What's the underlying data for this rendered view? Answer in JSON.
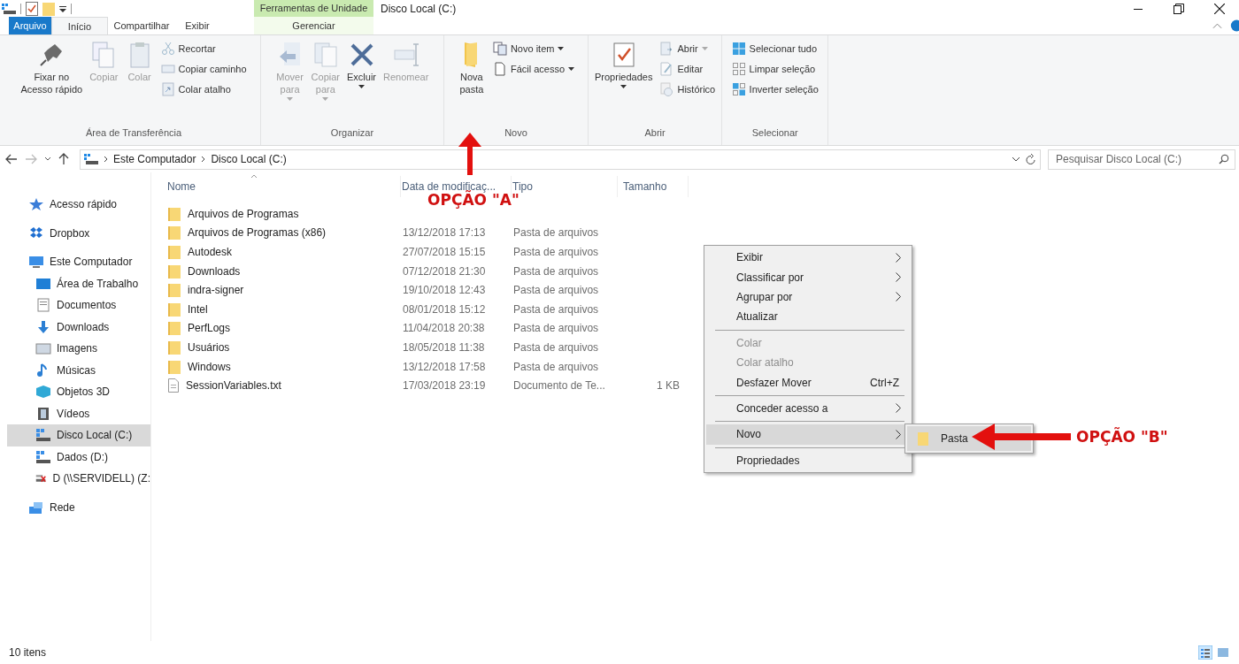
{
  "title_bar": {
    "contextual_label": "Ferramentas de Unidade",
    "title": "Disco Local (C:)"
  },
  "tabs": [
    {
      "label": "Arquivo",
      "kind": "file",
      "selected": false
    },
    {
      "label": "Início",
      "kind": "normal",
      "selected": true
    },
    {
      "label": "Compartilhar",
      "kind": "normal",
      "selected": false
    },
    {
      "label": "Exibir",
      "kind": "normal",
      "selected": false
    },
    {
      "label": "Gerenciar",
      "kind": "contextual",
      "selected": false
    }
  ],
  "ribbon": [
    {
      "label": "Área de Transferência",
      "commands": [
        {
          "lines": [
            "Fixar no",
            "Acesso rápido"
          ],
          "kind": "large",
          "disabled": false,
          "dropdown": false
        },
        {
          "lines": [
            "Copiar"
          ],
          "kind": "large",
          "disabled": true,
          "dropdown": false
        },
        {
          "lines": [
            "Colar"
          ],
          "kind": "large",
          "disabled": true,
          "dropdown": false
        },
        {
          "lines": [
            "Recortar"
          ],
          "kind": "small",
          "disabled": true,
          "dropdown": false
        },
        {
          "lines": [
            "Copiar caminho"
          ],
          "kind": "small",
          "disabled": true,
          "dropdown": false
        },
        {
          "lines": [
            "Colar atalho"
          ],
          "kind": "small",
          "disabled": true,
          "dropdown": false
        }
      ]
    },
    {
      "label": "Organizar",
      "commands": [
        {
          "lines": [
            "Mover",
            "para"
          ],
          "kind": "large",
          "disabled": true,
          "dropdown": true
        },
        {
          "lines": [
            "Copiar",
            "para"
          ],
          "kind": "large",
          "disabled": true,
          "dropdown": true
        },
        {
          "lines": [
            "Excluir"
          ],
          "kind": "large",
          "disabled": false,
          "dropdown": true
        },
        {
          "lines": [
            "Renomear"
          ],
          "kind": "large",
          "disabled": true,
          "dropdown": false
        }
      ]
    },
    {
      "label": "Novo",
      "commands": [
        {
          "lines": [
            "Nova",
            "pasta"
          ],
          "kind": "large",
          "disabled": false,
          "dropdown": false
        },
        {
          "lines": [
            "Novo item"
          ],
          "kind": "small",
          "disabled": false,
          "dropdown": true
        },
        {
          "lines": [
            "Fácil acesso"
          ],
          "kind": "small",
          "disabled": false,
          "dropdown": true
        }
      ]
    },
    {
      "label": "Abrir",
      "commands": [
        {
          "lines": [
            "Propriedades"
          ],
          "kind": "large",
          "disabled": false,
          "dropdown": true
        },
        {
          "lines": [
            "Abrir"
          ],
          "kind": "small",
          "disabled": true,
          "dropdown": true
        },
        {
          "lines": [
            "Editar"
          ],
          "kind": "small",
          "disabled": true,
          "dropdown": false
        },
        {
          "lines": [
            "Histórico"
          ],
          "kind": "small",
          "disabled": true,
          "dropdown": false
        }
      ]
    },
    {
      "label": "Selecionar",
      "commands": [
        {
          "lines": [
            "Selecionar tudo"
          ],
          "kind": "small",
          "disabled": false,
          "dropdown": false
        },
        {
          "lines": [
            "Limpar seleção"
          ],
          "kind": "small",
          "disabled": false,
          "dropdown": false
        },
        {
          "lines": [
            "Inverter seleção"
          ],
          "kind": "small",
          "disabled": false,
          "dropdown": false
        }
      ]
    }
  ],
  "address_bar": {
    "breadcrumb": [
      "Este Computador",
      "Disco Local (C:)"
    ],
    "search_placeholder": "Pesquisar Disco Local (C:)"
  },
  "sidebar": {
    "items": [
      {
        "label": "Acesso rápido",
        "selected": false
      },
      {
        "label": "Dropbox",
        "selected": false
      },
      {
        "label": "Este Computador",
        "selected": false,
        "children": [
          {
            "label": "Área de Trabalho",
            "selected": false
          },
          {
            "label": "Documentos",
            "selected": false
          },
          {
            "label": "Downloads",
            "selected": false
          },
          {
            "label": "Imagens",
            "selected": false
          },
          {
            "label": "Músicas",
            "selected": false
          },
          {
            "label": "Objetos 3D",
            "selected": false
          },
          {
            "label": "Vídeos",
            "selected": false
          },
          {
            "label": "Disco Local (C:)",
            "selected": true
          },
          {
            "label": "Dados (D:)",
            "selected": false
          },
          {
            "label": "D (\\\\SERVIDELL) (Z:",
            "selected": false
          }
        ]
      },
      {
        "label": "Rede",
        "selected": false
      }
    ]
  },
  "file_list": {
    "columns": [
      "Nome",
      "Data de modificaç...",
      "Tipo",
      "Tamanho"
    ],
    "rows": [
      {
        "kind": "folder",
        "name": "Arquivos de Programas"
      },
      {
        "kind": "folder",
        "name": "Arquivos de Programas (x86)",
        "date": "13/12/2018 17:13",
        "type": "Pasta de arquivos"
      },
      {
        "kind": "folder",
        "name": "Autodesk",
        "date": "27/07/2018 15:15",
        "type": "Pasta de arquivos"
      },
      {
        "kind": "folder",
        "name": "Downloads",
        "date": "07/12/2018 21:30",
        "type": "Pasta de arquivos"
      },
      {
        "kind": "folder",
        "name": "indra-signer",
        "date": "19/10/2018 12:43",
        "type": "Pasta de arquivos"
      },
      {
        "kind": "folder",
        "name": "Intel",
        "date": "08/01/2018 15:12",
        "type": "Pasta de arquivos"
      },
      {
        "kind": "folder",
        "name": "PerfLogs",
        "date": "11/04/2018 20:38",
        "type": "Pasta de arquivos"
      },
      {
        "kind": "folder",
        "name": "Usuários",
        "date": "18/05/2018 11:38",
        "type": "Pasta de arquivos"
      },
      {
        "kind": "folder",
        "name": "Windows",
        "date": "13/12/2018 17:58",
        "type": "Pasta de arquivos"
      },
      {
        "kind": "file",
        "name": "SessionVariables.txt",
        "date": "17/03/2018 23:19",
        "type": "Documento de Te...",
        "size": "1 KB"
      }
    ]
  },
  "context_menu": {
    "items": [
      {
        "kind": "item",
        "label": "Exibir",
        "submenu": true,
        "disabled": false,
        "selected": false
      },
      {
        "kind": "item",
        "label": "Classificar por",
        "submenu": true,
        "disabled": false,
        "selected": false
      },
      {
        "kind": "item",
        "label": "Agrupar por",
        "submenu": true,
        "disabled": false,
        "selected": false
      },
      {
        "kind": "item",
        "label": "Atualizar",
        "submenu": false,
        "disabled": false,
        "selected": false
      },
      {
        "kind": "separator"
      },
      {
        "kind": "item",
        "label": "Colar",
        "submenu": false,
        "disabled": true,
        "selected": false
      },
      {
        "kind": "item",
        "label": "Colar atalho",
        "submenu": false,
        "disabled": true,
        "selected": false
      },
      {
        "kind": "item",
        "label": "Desfazer Mover",
        "shortcut": "Ctrl+Z",
        "submenu": false,
        "disabled": false,
        "selected": false
      },
      {
        "kind": "separator"
      },
      {
        "kind": "item",
        "label": "Conceder acesso a",
        "submenu": true,
        "disabled": false,
        "selected": false
      },
      {
        "kind": "separator"
      },
      {
        "kind": "item",
        "label": "Novo",
        "submenu": true,
        "disabled": false,
        "selected": true
      },
      {
        "kind": "separator"
      },
      {
        "kind": "item",
        "label": "Propriedades",
        "submenu": false,
        "disabled": false,
        "selected": false
      }
    ],
    "submenu": [
      {
        "label": "Pasta",
        "selected": true
      }
    ]
  },
  "annotations": [
    {
      "label": "OPÇÃO \"A\""
    },
    {
      "label": "OPÇÃO \"B\""
    }
  ],
  "status_bar": {
    "item_count": "10 itens",
    "views": [
      {
        "selected": true
      },
      {
        "selected": false
      }
    ]
  }
}
